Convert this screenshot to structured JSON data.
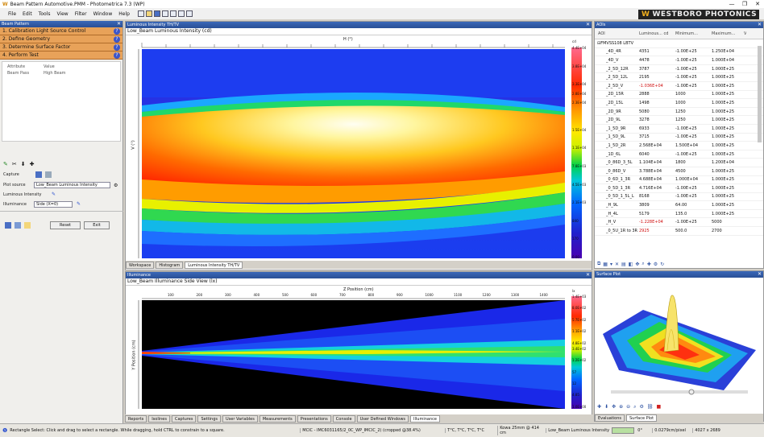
{
  "window": {
    "title": "Beam Pattern Automotive.PMM - Photometrica 7.3 (WP)",
    "minimize": "—",
    "restore": "❐",
    "close": "✕"
  },
  "menu": [
    "File",
    "Edit",
    "Tools",
    "View",
    "Filter",
    "Window",
    "Help"
  ],
  "brand": {
    "mark": "W",
    "name": "WESTBORO  PHOTONICS"
  },
  "left_panel": {
    "title": "Beam Pattern",
    "steps": [
      {
        "label": "1. Calibration Light Source Control"
      },
      {
        "label": "2. Define Geometry"
      },
      {
        "label": "3. Determine Surface Factor"
      },
      {
        "label": "4. Perform Test"
      }
    ],
    "help_glyph": "?",
    "prop_headers": [
      "Attribute",
      "Value"
    ],
    "prop_row": {
      "name": "Beam Pass",
      "value": "High Beam"
    },
    "tool_glyphs": [
      "✎",
      "✂",
      "⬇",
      "✚"
    ],
    "capture_label": "Capture",
    "plot_source_label": "Plot source",
    "plot_source_value": "Low_Beam Luminous Intensity",
    "luminous_intensity_label": "Luminous Intensity",
    "illuminance_label": "Illuminance",
    "illuminance_value": "Side (X=0)",
    "reset": "Reset",
    "exit": "Exit"
  },
  "top_chart": {
    "panel_title": "Luminous Intensity TH/TV",
    "header": "Low_Beam Luminous Intensity (cd)",
    "x_axis_label": "H (°)",
    "y_axis_label": "V (°)",
    "unit": "cd",
    "scale_labels": [
      "4.4E+04",
      "",
      "3.8E+04",
      "",
      "3.3E+04",
      "2.8E+04",
      "2.3E+04",
      "",
      "",
      "1.5E+04",
      "",
      "1.1E+04",
      "",
      "7.8E+03",
      "",
      "4.5E+03",
      "",
      "2.1E+03",
      "",
      "840",
      "",
      "170",
      "",
      "0.00"
    ],
    "tabs": [
      "Workspace",
      "Histogram",
      "Luminous Intensity TH/TV"
    ]
  },
  "bottom_chart": {
    "panel_title": "Illuminance",
    "header": "Low_Beam Illuminance Side View (lx)",
    "x_axis_label": "Z Position (cm)",
    "y_axis_label": "Y Position (cm)",
    "x_ticks": [
      "100",
      "200",
      "300",
      "400",
      "500",
      "600",
      "700",
      "800",
      "900",
      "1000",
      "1100",
      "1200",
      "1300",
      "1400"
    ],
    "unit": "lx",
    "scale_labels": [
      "1.4E+03",
      "",
      "8.0E+02",
      "",
      "5.7E+02",
      "",
      "1.1E+02",
      "",
      "4.8E+02",
      "3.4E+02",
      "",
      "1.2E+02",
      "",
      "57",
      "",
      "12",
      "",
      "4.85",
      "",
      "1.0E+00"
    ],
    "tabs": [
      "Reports",
      "Isolines",
      "Captures",
      "Settings",
      "User Variables",
      "Measurements",
      "Presentations",
      "Console",
      "User Defined Windows",
      "Illuminance"
    ]
  },
  "aoi_panel": {
    "title": "AOIs",
    "columns": [
      "AOI",
      "Luminous... cd",
      "Minimum...",
      "Maximum...",
      "V"
    ],
    "group": "FMVSS108 LBTV",
    "rows": [
      {
        "name": "_4D_4R",
        "lum": "4351",
        "min": "-1.00E+25",
        "max": "1.250E+04"
      },
      {
        "name": "_4D_V",
        "lum": "4478",
        "min": "-1.00E+25",
        "max": "1.000E+04"
      },
      {
        "name": "_2_5D_12R",
        "lum": "3787",
        "min": "-1.00E+25",
        "max": "1.000E+25"
      },
      {
        "name": "_2_5D_12L",
        "lum": "2195",
        "min": "-1.00E+25",
        "max": "1.000E+25"
      },
      {
        "name": "_2_5D_V",
        "lum": "-1.036E+04",
        "min": "-1.00E+25",
        "max": "1.000E+25"
      },
      {
        "name": "_2D_15R",
        "lum": "2888",
        "min": "1000",
        "max": "1.000E+25"
      },
      {
        "name": "_2D_15L",
        "lum": "1498",
        "min": "1000",
        "max": "1.000E+25"
      },
      {
        "name": "_2D_9R",
        "lum": "5080",
        "min": "1250",
        "max": "1.000E+25"
      },
      {
        "name": "_2D_9L",
        "lum": "3278",
        "min": "1250",
        "max": "1.000E+25"
      },
      {
        "name": "_1_5D_9R",
        "lum": "6933",
        "min": "-1.00E+25",
        "max": "1.000E+25"
      },
      {
        "name": "_1_5D_9L",
        "lum": "3715",
        "min": "-1.00E+25",
        "max": "1.000E+25"
      },
      {
        "name": "_1_5D_2R",
        "lum": "2.568E+04",
        "min": "1.500E+04",
        "max": "1.000E+25"
      },
      {
        "name": "_1D_6L",
        "lum": "6040",
        "min": "-1.00E+25",
        "max": "1.000E+25"
      },
      {
        "name": "_0_86D_3_5L",
        "lum": "1.104E+04",
        "min": "1800",
        "max": "1.200E+04"
      },
      {
        "name": "_0_86D_V",
        "lum": "3.788E+04",
        "min": "4500",
        "max": "1.000E+25"
      },
      {
        "name": "_0_6D_1_3R",
        "lum": "4.688E+04",
        "min": "1.000E+04",
        "max": "1.000E+25"
      },
      {
        "name": "_0_5D_1_3R",
        "lum": "4.716E+04",
        "min": "-1.00E+25",
        "max": "1.000E+25"
      },
      {
        "name": "_0_5D_1_5L_L",
        "lum": "8168",
        "min": "-1.00E+25",
        "max": "1.000E+25"
      },
      {
        "name": "_H_9L",
        "lum": "3809",
        "min": "64.00",
        "max": "1.000E+25"
      },
      {
        "name": "_H_4L",
        "lum": "5179",
        "min": "135.0",
        "max": "1.000E+25"
      },
      {
        "name": "_H_V",
        "lum": "-1.228E+04",
        "min": "-1.00E+25",
        "max": "5000"
      },
      {
        "name": "_0_5U_1R to 3R",
        "lum": "2925",
        "min": "500.0",
        "max": "2700"
      }
    ]
  },
  "surface_plot": {
    "title": "Surface Plot",
    "tabs": [
      "Evaluations",
      "Surface Plot"
    ]
  },
  "status": {
    "hint": "Rectangle Select: Click and drag to select a rectangle. While dragging, hold CTRL to constrain to a square.",
    "file": "MCIC - IMC6031165/2_0C_WP_IMCIC_2) (cropped @38.4%)",
    "temps": "T°C, T°C, T°C, T°C",
    "lens": "Kowa 25mm @ 414 cm",
    "source": "Low_Beam Luminous Intensity",
    "value": "0°",
    "pixel": "0.0279cm/pixel",
    "size": "4027 x 2689"
  },
  "colors": {
    "accent": "#2a4f96",
    "step_bg": "#e8a259",
    "brand_bg": "#222222",
    "brand_mark": "#f2b01e"
  }
}
